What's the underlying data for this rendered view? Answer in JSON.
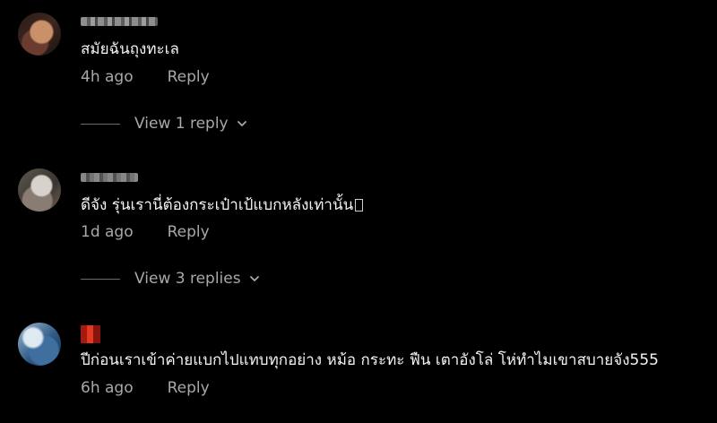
{
  "comments": [
    {
      "username": "",
      "text": "สมัยฉันถุงทะเล",
      "time": "4h ago",
      "reply_label": "Reply",
      "view_replies_label": "View 1 reply"
    },
    {
      "username": "",
      "text": "ดีจัง รุ่นเรานี่ต้องกระเป๋าเป้แบกหลังเท่านั้น",
      "time": "1d ago",
      "reply_label": "Reply",
      "view_replies_label": "View 3 replies"
    },
    {
      "username": "",
      "text": "ปีก่อนเราเข้าค่ายแบกไปแทบทุกอย่าง หม้อ กระทะ ฟืน เตาอังโล่ โห่ทำไมเขาสบายจัง555",
      "time": "6h ago",
      "reply_label": "Reply"
    }
  ],
  "colors": {
    "background": "#000000",
    "text": "#f3f3f3",
    "secondary_text": "#a8a8aa"
  },
  "icons": {
    "expand": "chevron-down-icon"
  }
}
